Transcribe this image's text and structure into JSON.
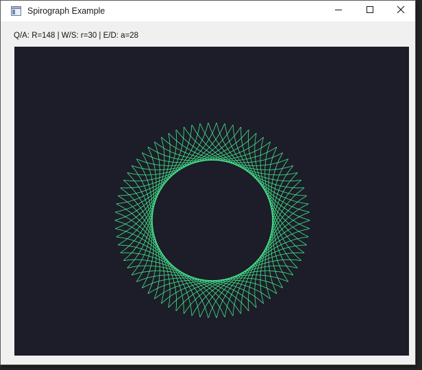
{
  "window": {
    "title": "Spirograph Example",
    "icon": "app-window-icon",
    "controls": {
      "minimize_icon": "minimize-icon",
      "maximize_icon": "maximize-icon",
      "close_icon": "close-icon"
    }
  },
  "status": {
    "text": "Q/A: R=148 | W/S: r=30 | E/D: a=28"
  },
  "spirograph": {
    "R": 148,
    "r": 30,
    "a": 28,
    "background_color": "#1c1d28",
    "stroke_color": "#48f291"
  }
}
